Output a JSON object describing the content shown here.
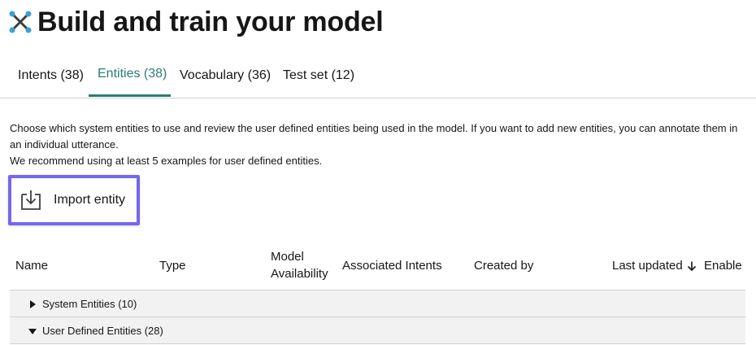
{
  "page": {
    "title": "Build and train your model"
  },
  "tabs": [
    {
      "label": "Intents (38)",
      "active": false
    },
    {
      "label": "Entities (38)",
      "active": true
    },
    {
      "label": "Vocabulary (36)",
      "active": false
    },
    {
      "label": "Test set (12)",
      "active": false
    }
  ],
  "description": {
    "line1": "Choose which system entities to use and review the user defined entities being used in the model. If you want to add new entities, you can annotate them in an individual utterance.",
    "line2": "We recommend using at least 5 examples for user defined entities."
  },
  "import_button": {
    "label": "Import entity",
    "icon": "import-download-icon"
  },
  "table": {
    "headers": {
      "name": "Name",
      "type": "Type",
      "model_availability": "Model Availability",
      "associated_intents": "Associated Intents",
      "created_by": "Created by",
      "last_updated": "Last updated",
      "enable": "Enable"
    },
    "sort_icon": "arrow-down-icon",
    "groups": [
      {
        "label": "System Entities (10)",
        "expanded": false
      },
      {
        "label": "User Defined Entities (28)",
        "expanded": true
      }
    ]
  },
  "colors": {
    "accent": "#2a7d73",
    "highlight": "#7467f0",
    "row_bg": "#f2f2f2",
    "divider": "#cfcfcf"
  }
}
